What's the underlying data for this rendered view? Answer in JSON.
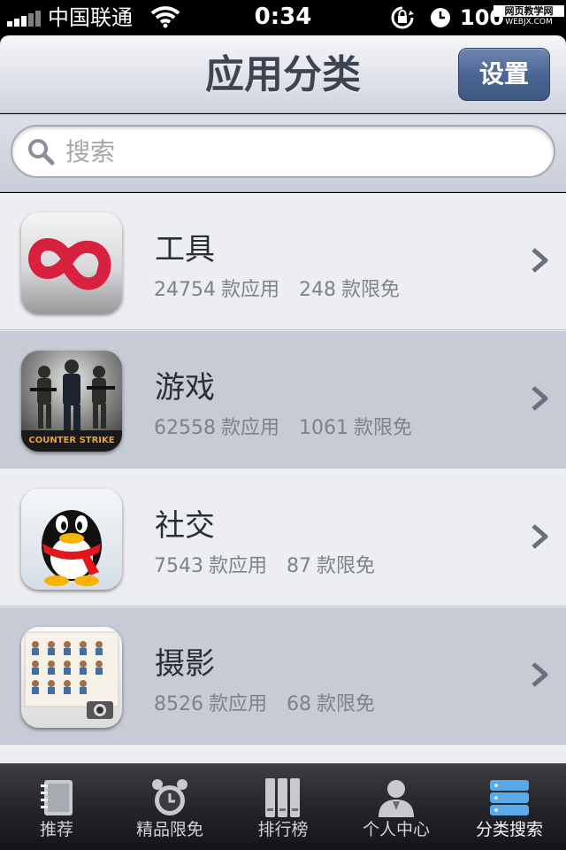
{
  "status_bar": {
    "carrier": "中国联通",
    "time": "0:34",
    "battery": "100",
    "watermark_line1": "网页教学网",
    "watermark_line2": "WEBJX.COM"
  },
  "nav": {
    "title": "应用分类",
    "settings_label": "设置"
  },
  "search": {
    "placeholder": "搜索",
    "value": ""
  },
  "categories": [
    {
      "name": "工具",
      "apps": "24754",
      "apps_unit": "款应用",
      "free": "248",
      "free_unit": "款限免",
      "icon": "tools-app-icon"
    },
    {
      "name": "游戏",
      "apps": "62558",
      "apps_unit": "款应用",
      "free": "1061",
      "free_unit": "款限免",
      "icon": "counter-strike-app-icon"
    },
    {
      "name": "社交",
      "apps": "7543",
      "apps_unit": "款应用",
      "free": "87",
      "free_unit": "款限免",
      "icon": "qq-penguin-app-icon"
    },
    {
      "name": "摄影",
      "apps": "8526",
      "apps_unit": "款应用",
      "free": "68",
      "free_unit": "款限免",
      "icon": "photo-grid-app-icon"
    }
  ],
  "counter_strike_logo": "COUNTER STRIKE",
  "tabs": [
    {
      "label": "推荐",
      "icon": "notebook-icon"
    },
    {
      "label": "精品限免",
      "icon": "alarm-clock-icon"
    },
    {
      "label": "排行榜",
      "icon": "ranking-bars-icon"
    },
    {
      "label": "个人中心",
      "icon": "person-icon"
    },
    {
      "label": "分类搜索",
      "icon": "category-stack-icon",
      "active": true
    }
  ],
  "colors": {
    "nav_button": "#4c6694",
    "row_light": "#edeef2",
    "row_dark": "#c7cbd5",
    "tab_active": "#5aa9e8"
  }
}
